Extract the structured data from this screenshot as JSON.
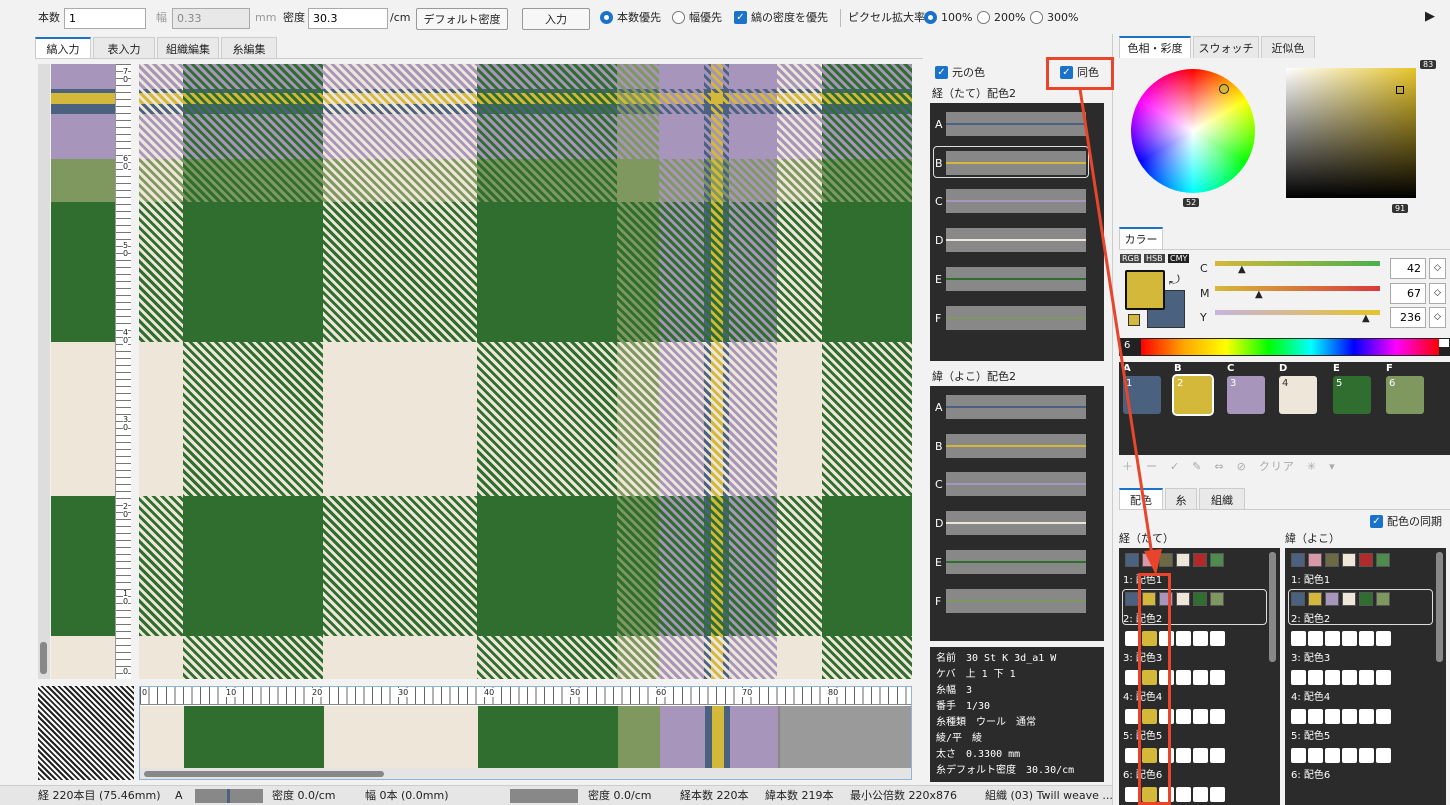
{
  "toolbar": {
    "count_label": "本数",
    "count_value": "1",
    "width_label": "幅",
    "width_value": "0.33",
    "width_unit": "mm",
    "density_label": "密度",
    "density_value": "30.3",
    "density_unit": "/cm",
    "default_density_btn": "デフォルト密度",
    "input_btn": "入力",
    "count_priority": "本数優先",
    "width_priority": "幅優先",
    "stripe_density_priority": "縞の密度を優先",
    "pixel_zoom_label": "ピクセル拡大率",
    "zoom_100": "100%",
    "zoom_200": "200%",
    "zoom_300": "300%"
  },
  "tabs": [
    "縞入力",
    "表入力",
    "組織編集",
    "糸編集"
  ],
  "middle": {
    "original_color": "元の色",
    "same_color": "同色",
    "warp_title": "経（たて）配色2",
    "weft_title": "緯（よこ）配色2",
    "letters": [
      "A",
      "B",
      "C",
      "D",
      "E",
      "F"
    ]
  },
  "yarn_info": [
    "名前　30 St K 3d_a1 W",
    "ケバ　上 1 下 1",
    "糸幅　3",
    "番手　1/30",
    "糸種類　ウール　通常",
    "綾/平　綾",
    "太さ　0.3300 mm",
    "糸デフォルト密度　30.30/cm"
  ],
  "ruler_v": [
    "7\n0",
    "6\n0",
    "5\n0",
    "4\n0",
    "3\n0",
    "2\n0",
    "1\n0",
    "0"
  ],
  "ruler_h": [
    "0",
    "10",
    "20",
    "30",
    "40",
    "50",
    "60",
    "70",
    "80"
  ],
  "status": {
    "warp_pos": "経 220本目 (75.46mm)",
    "letter": "A",
    "density1": "密度 0.0/cm",
    "width": "幅 0本 (0.0mm)",
    "density2": "密度 0.0/cm",
    "warp_count": "経本数 220本",
    "weft_count": "緯本数 219本",
    "lcm": "最小公倍数 220x876",
    "weave": "組織 (03) Twill weave ..."
  },
  "right": {
    "tabs_top": [
      "色相・彩度",
      "スウォッチ",
      "近似色"
    ],
    "hue_val": "52",
    "sat_val": "83",
    "bri_val": "91",
    "color_tab": "カラー",
    "modes": [
      "RGB",
      "HSB",
      "CMY"
    ],
    "channels": [
      {
        "name": "C",
        "value": "42"
      },
      {
        "name": "M",
        "value": "67"
      },
      {
        "name": "Y",
        "value": "236"
      }
    ],
    "spectrum_num": "6",
    "palette_letters": [
      "A",
      "B",
      "C",
      "D",
      "E",
      "F"
    ],
    "palette_nums": [
      "1",
      "2",
      "3",
      "4",
      "5",
      "6"
    ],
    "toolbar": "＋　ー　✓　✎　⇔　⊘　クリア　✳　▾",
    "tabs_bottom": [
      "配色",
      "糸",
      "組織"
    ],
    "sync_label": "配色の同期",
    "warp_list_title": "経（たて）",
    "weft_list_title": "緯（よこ）",
    "items": [
      "1: 配色1",
      "2: 配色2",
      "3: 配色3",
      "4: 配色4",
      "5: 配色5",
      "6: 配色6"
    ]
  },
  "colors": {
    "A": "#4a6280",
    "B": "#d4b83a",
    "C": "#a895bc",
    "D": "#eee6d8",
    "E": "#2f6e2f",
    "F": "#7f9860",
    "accent": "#1a73c9",
    "annot": "#e8452a"
  }
}
